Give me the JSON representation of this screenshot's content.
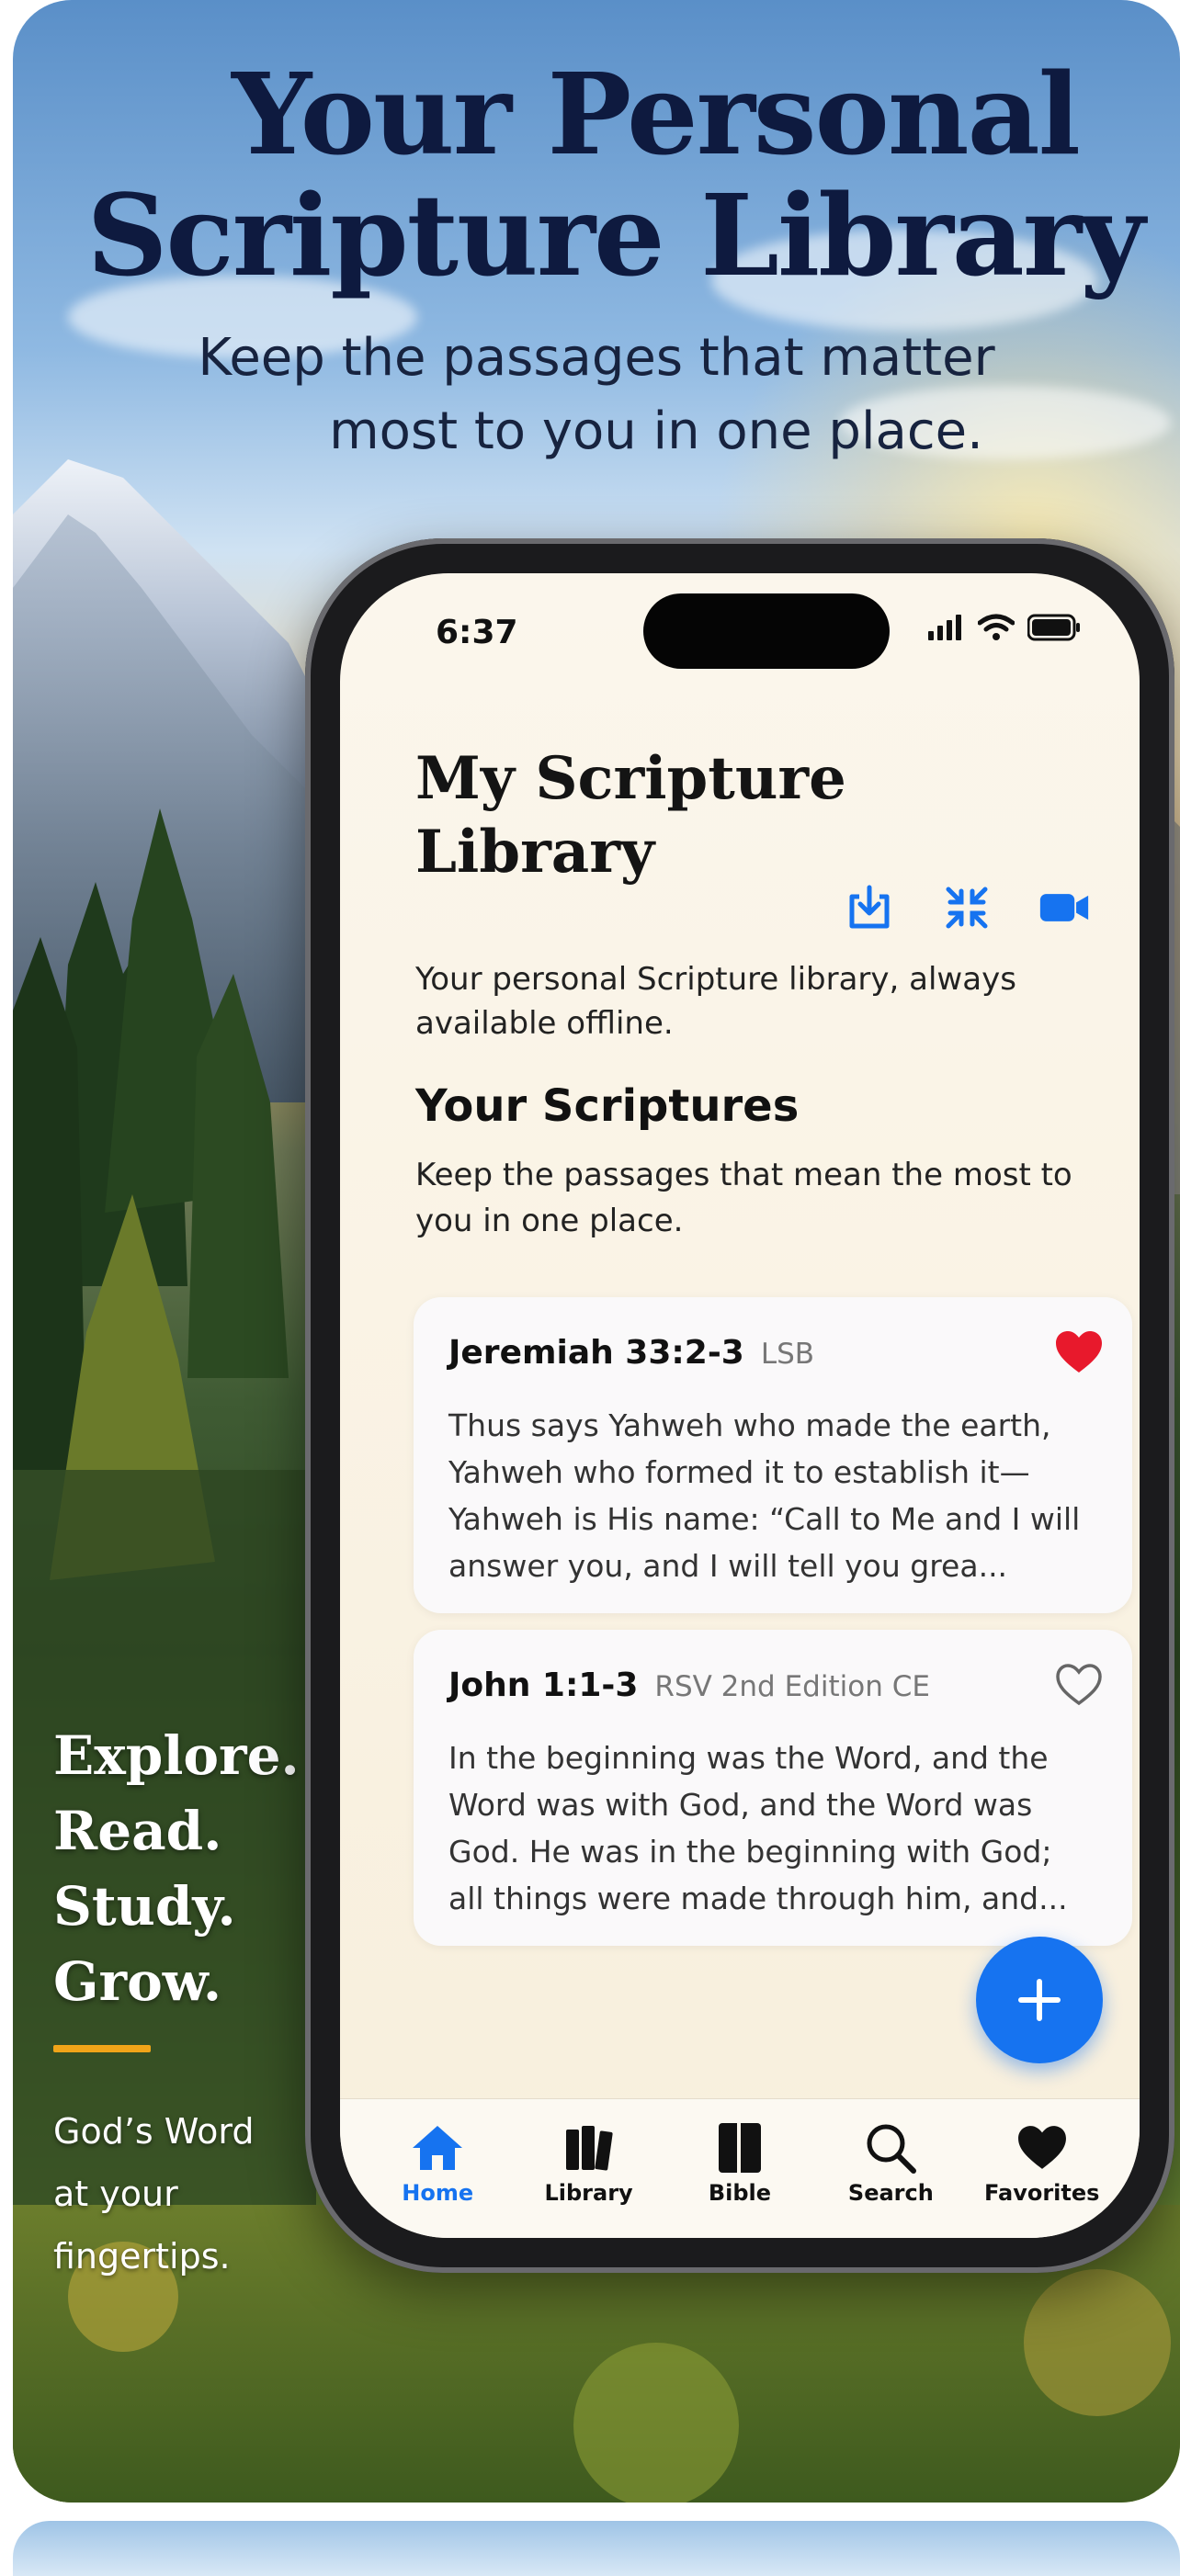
{
  "headline": {
    "line1": "Your Personal",
    "line2": "Scripture Library",
    "sub_line1": "Keep the passages that matter",
    "sub_line2": "most to you in one place."
  },
  "tagline": {
    "words": [
      "Explore.",
      "Read.",
      "Study.",
      "Grow."
    ],
    "sub_line1": "God’s Word",
    "sub_line2": "at your",
    "sub_line3": "fingertips."
  },
  "colors": {
    "accent": "#1673f0",
    "favorite_red": "#e8192c",
    "divider_gold": "#f0a419",
    "headline_navy": "#0e1a3f"
  },
  "status_bar": {
    "time": "6:37",
    "icons": [
      "signal-icon",
      "wifi-icon",
      "battery-icon"
    ]
  },
  "app": {
    "title": "My Scripture Library",
    "subtitle": "Your personal Scripture library, always available offline.",
    "toolbar_icons": [
      "import-icon",
      "collapse-icon",
      "video-icon"
    ],
    "section_title": "Your Scriptures",
    "section_subtitle": "Keep the passages that mean the most to you in one place."
  },
  "verses": [
    {
      "reference": "Jeremiah 33:2-3",
      "version": "LSB",
      "favorited": true,
      "text": "Thus says Yahweh who made the earth, Yahweh who formed it to establish it—Yahweh is His name: “Call to Me and I will answer you, and I will tell you grea..."
    },
    {
      "reference": "John 1:1-3",
      "version": "RSV 2nd Edition CE",
      "favorited": false,
      "text": "In the beginning was the Word, and the Word was with God, and the Word was God. He was in the beginning with God; all things were made through him, and..."
    }
  ],
  "fab": {
    "icon": "plus-icon"
  },
  "tabs": [
    {
      "label": "Home",
      "icon": "home-icon",
      "active": true
    },
    {
      "label": "Library",
      "icon": "library-icon",
      "active": false
    },
    {
      "label": "Bible",
      "icon": "bible-icon",
      "active": false
    },
    {
      "label": "Search",
      "icon": "search-icon",
      "active": false
    },
    {
      "label": "Favorites",
      "icon": "heart-icon",
      "active": false
    }
  ]
}
